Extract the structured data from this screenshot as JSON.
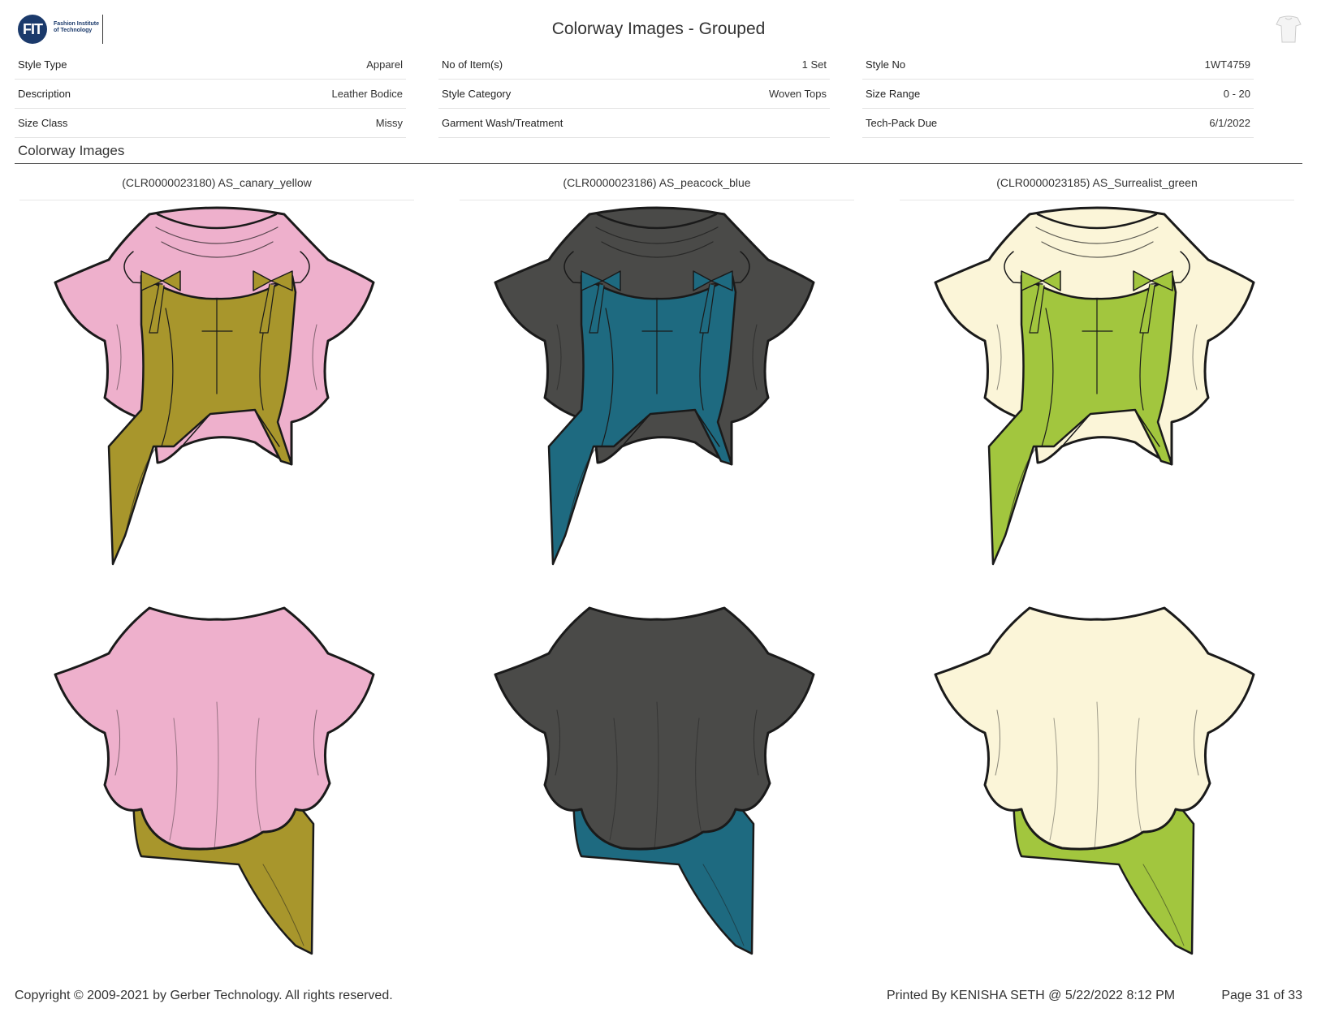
{
  "header": {
    "logo_mark": "FIT",
    "logo_text": "Fashion Institute of Technology",
    "title": "Colorway Images - Grouped",
    "corner_icon": "garment-thumbnail-icon"
  },
  "meta": {
    "col1": [
      {
        "label": "Style Type",
        "value": "Apparel"
      },
      {
        "label": "Description",
        "value": "Leather Bodice"
      },
      {
        "label": "Size Class",
        "value": "Missy"
      }
    ],
    "col2": [
      {
        "label": "No of Item(s)",
        "value": "1 Set"
      },
      {
        "label": "Style Category",
        "value": "Woven Tops"
      },
      {
        "label": "Garment Wash/Treatment",
        "value": ""
      }
    ],
    "col3": [
      {
        "label": "Style No",
        "value": "1WT4759"
      },
      {
        "label": "Size Range",
        "value": "0 - 20"
      },
      {
        "label": "Tech-Pack Due",
        "value": "6/1/2022"
      }
    ]
  },
  "section": {
    "title": "Colorway Images"
  },
  "colorways": [
    {
      "title": "(CLR0000023180) AS_canary_yellow",
      "overlay_color": "#eeb0cc",
      "bodice_color": "#a8962c"
    },
    {
      "title": "(CLR0000023186) AS_peacock_blue",
      "overlay_color": "#4a4a48",
      "bodice_color": "#1e6a80"
    },
    {
      "title": "(CLR0000023185) AS_Surrealist_green",
      "overlay_color": "#fbf5d8",
      "bodice_color": "#a2c63e"
    }
  ],
  "footer": {
    "copyright": "Copyright © 2009-2021 by Gerber Technology. All rights reserved.",
    "printed": "Printed By KENISHA SETH @ 5/22/2022 8:12 PM",
    "page": "Page 31 of 33"
  }
}
